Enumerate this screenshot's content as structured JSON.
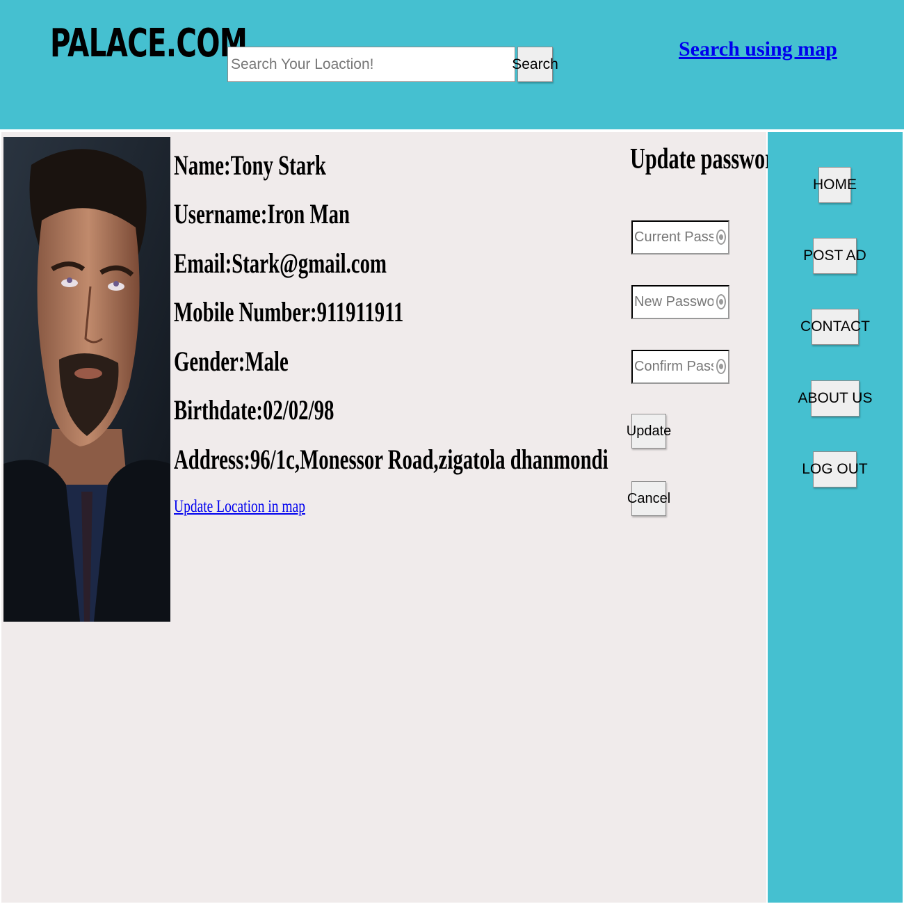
{
  "header": {
    "logo": "PALACE.COM",
    "search": {
      "placeholder": "Search Your Loaction!",
      "value": "",
      "button_label": "Search"
    },
    "map_link": "Search using map"
  },
  "profile": {
    "photo": "profile-photo",
    "name": "Name:Tony Stark",
    "username": "Username:Iron Man",
    "email": "Email:Stark@gmail.com",
    "mobile": "Mobile Number:911911911",
    "gender": "Gender:Male",
    "birthdate": "Birthdate:02/02/98",
    "address": "Address:96/1c,Monessor Road,zigatola dhanmondi",
    "update_location_link": "Update Location in map"
  },
  "password_form": {
    "title": "Update password",
    "current_placeholder": "Current Password",
    "new_placeholder": "New Password",
    "confirm_placeholder": "Confirm Password",
    "update_label": "Update",
    "cancel_label": "Cancel"
  },
  "sidebar": {
    "items": [
      {
        "label": "HOME"
      },
      {
        "label": "POST AD"
      },
      {
        "label": "CONTACT"
      },
      {
        "label": "ABOUT US"
      },
      {
        "label": "LOG OUT"
      }
    ]
  },
  "colors": {
    "header_bg": "#45c0d0",
    "content_bg": "#f0ebeb",
    "link": "#0000ee"
  },
  "icons": {
    "password_reveal": "eye-icon"
  }
}
